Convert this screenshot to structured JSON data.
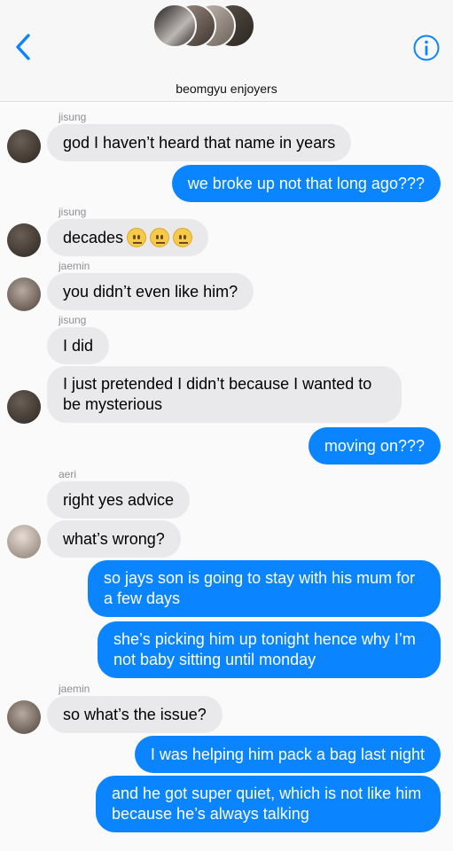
{
  "header": {
    "title": "beomgyu enjoyers",
    "back_icon": "chevron-left-icon",
    "info_icon": "info-icon",
    "accent": "#0a84ff"
  },
  "messages": [
    {
      "sender": "jisung",
      "text": "god I haven’t heard that name in years"
    },
    {
      "text": "we broke up not that long ago???"
    },
    {
      "sender": "jisung",
      "text": "decades"
    },
    {
      "sender": "jaemin",
      "text": "you didn’t even like him?"
    },
    {
      "sender": "jisung",
      "text": "I did"
    },
    {
      "text": "I just pretended I didn’t because I wanted to be mysterious"
    },
    {
      "text": "moving on???"
    },
    {
      "sender": "aeri",
      "text": "right yes advice"
    },
    {
      "text": "what’s wrong?"
    },
    {
      "text": "so jays son is going to stay with his mum for a few days"
    },
    {
      "text": "she’s picking him up tonight hence why I’m not baby sitting until monday"
    },
    {
      "sender": "jaemin",
      "text": "so what’s the issue?"
    },
    {
      "text": "I was helping him pack a bag last night"
    },
    {
      "text": "and he got super quiet, which is not like him because he’s always talking"
    }
  ],
  "colors": {
    "incoming_bubble": "#e9e9eb",
    "outgoing_bubble": "#0a84ff",
    "sender_label": "#8e8e93"
  }
}
